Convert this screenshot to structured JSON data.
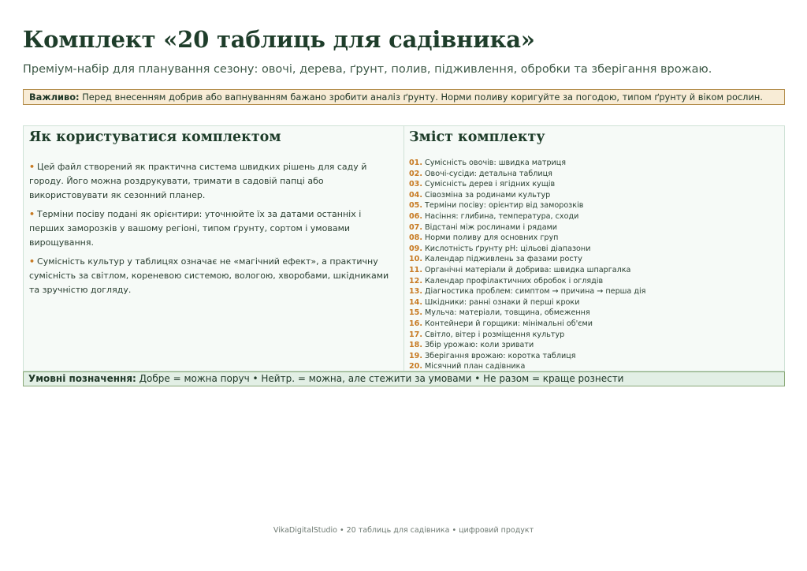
{
  "header": {
    "title": "Комплект «20 таблиць для садівника»",
    "subtitle": "Преміум-набір для планування сезону: овочі, дерева, ґрунт, полив, підживлення, обробки та зберігання врожаю."
  },
  "notice": {
    "label": "Важливо:",
    "text": " Перед внесенням добрив або вапнуванням бажано зробити аналіз ґрунту. Норми поливу коригуйте за погодою, типом ґрунту й віком рослин."
  },
  "usage": {
    "title": "Як користуватися комплектом",
    "bullet": "•",
    "items": [
      "Цей файл створений як практична система швидких рішень для саду й городу. Його можна роздрукувати, тримати в садовій папці або використовувати як сезонний планер.",
      "Терміни посіву подані як орієнтири: уточнюйте їх за датами останніх і перших заморозків у вашому регіоні, типом ґрунту, сортом і умовами вирощування.",
      "Сумісність культур у таблицях означає не «магічний ефект», а практичну сумісність за світлом, кореневою системою, вологою, хворобами, шкідниками та зручністю догляду."
    ]
  },
  "contents": {
    "title": "Зміст комплекту",
    "items": [
      {
        "num": "01.",
        "text": "Сумісність овочів: швидка матриця"
      },
      {
        "num": "02.",
        "text": "Овочі-сусіди: детальна таблиця"
      },
      {
        "num": "03.",
        "text": "Сумісність дерев і ягідних кущів"
      },
      {
        "num": "04.",
        "text": "Сівозміна за родинами культур"
      },
      {
        "num": "05.",
        "text": "Терміни посіву: орієнтир від заморозків"
      },
      {
        "num": "06.",
        "text": "Насіння: глибина, температура, сходи"
      },
      {
        "num": "07.",
        "text": "Відстані між рослинами і рядами"
      },
      {
        "num": "08.",
        "text": "Норми поливу для основних груп"
      },
      {
        "num": "09.",
        "text": "Кислотність ґрунту pH: цільові діапазони"
      },
      {
        "num": "10.",
        "text": "Календар підживлень за фазами росту"
      },
      {
        "num": "11.",
        "text": "Органічні матеріали й добрива: швидка шпаргалка"
      },
      {
        "num": "12.",
        "text": "Календар профілактичних обробок і оглядів"
      },
      {
        "num": "13.",
        "text": "Діагностика проблем: симптом → причина → перша дія"
      },
      {
        "num": "14.",
        "text": "Шкідники: ранні ознаки й перші кроки"
      },
      {
        "num": "15.",
        "text": "Мульча: матеріали, товщина, обмеження"
      },
      {
        "num": "16.",
        "text": "Контейнери й горщики: мінімальні об'єми"
      },
      {
        "num": "17.",
        "text": "Світло, вітер і розміщення культур"
      },
      {
        "num": "18.",
        "text": "Збір урожаю: коли зривати"
      },
      {
        "num": "19.",
        "text": "Зберігання врожаю: коротка таблиця"
      },
      {
        "num": "20.",
        "text": "Місячний план садівника"
      }
    ]
  },
  "legend": {
    "label": "Умовні позначення:",
    "text": " Добре = можна поруч • Нейтр. = можна, але стежити за умовами • Не разом = краще рознести"
  },
  "footer": {
    "text": "VikaDigitalStudio • 20 таблиць для садівника • цифровий продукт"
  },
  "colors": {
    "title": "#1e3d2a",
    "accent": "#c77a22",
    "notice_bg": "#f8ecd6",
    "notice_border": "#b58f4e",
    "panel_bg": "#f6faf7",
    "legend_bg": "#e2efe5"
  }
}
